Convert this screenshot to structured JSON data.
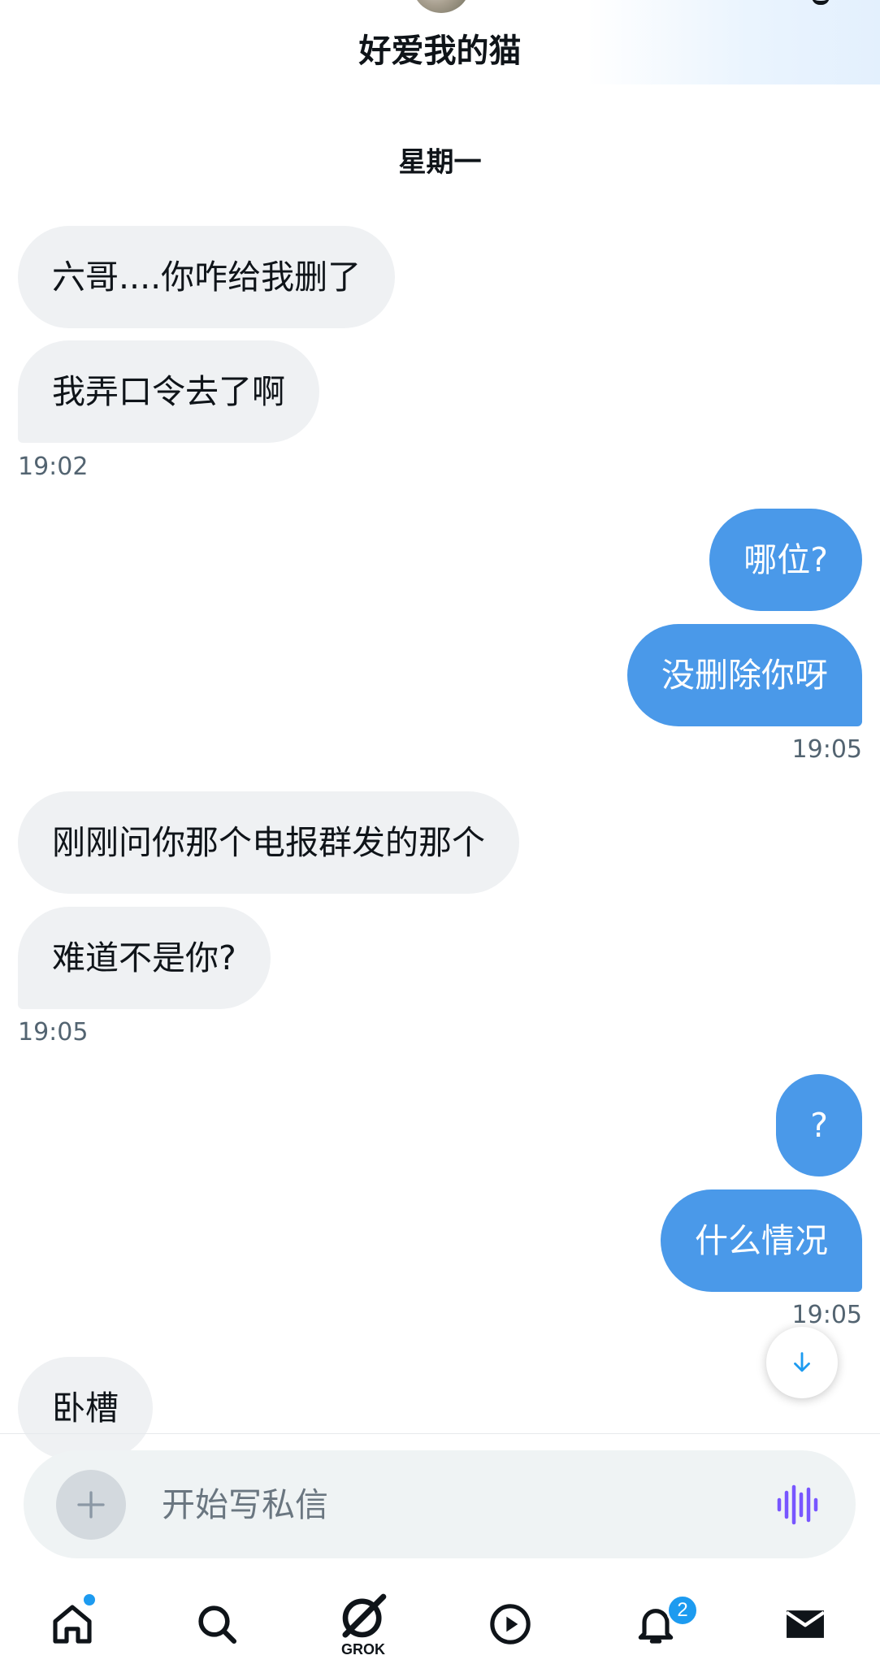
{
  "header": {
    "title": "好爱我的猫"
  },
  "day_separator": "星期一",
  "messages": [
    {
      "text": "六哥....你咋给我删了"
    },
    {
      "text": "我弄口令去了啊"
    },
    {
      "time": "19:02"
    },
    {
      "text": "哪位?"
    },
    {
      "text": "没删除你呀"
    },
    {
      "time": "19:05"
    },
    {
      "text": "刚刚问你那个电报群发的那个"
    },
    {
      "text": "难道不是你?"
    },
    {
      "time": "19:05"
    },
    {
      "text": "?"
    },
    {
      "text": "什么情况"
    },
    {
      "time": "19:05"
    },
    {
      "text": "卧槽"
    }
  ],
  "composer": {
    "placeholder": "开始写私信"
  },
  "nav": {
    "grok_label": "GROK",
    "notifications_count": "2"
  },
  "colors": {
    "accent": "#1d9bf0",
    "outgoing_bubble": "#4a99e9",
    "incoming_bubble": "#eff1f3",
    "voice_icon": "#7856ff"
  },
  "icons": [
    "home-icon",
    "search-icon",
    "grok-icon",
    "play-icon",
    "bell-icon",
    "mail-icon",
    "plus-icon",
    "voice-wave-icon",
    "arrow-down-icon"
  ]
}
